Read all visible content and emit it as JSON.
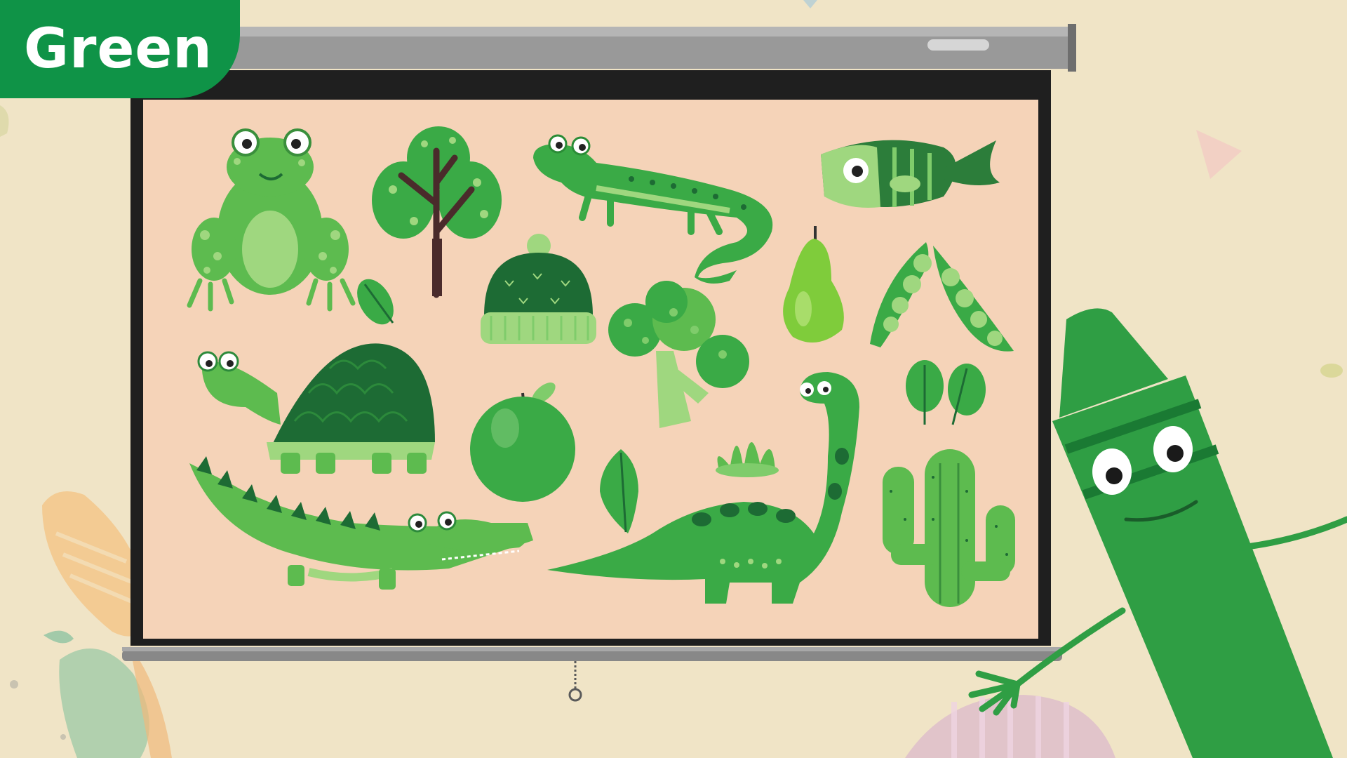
{
  "title": {
    "text": "Green"
  },
  "colors": {
    "background": "#f0e4c6",
    "title_tag": "#0f9347",
    "screen": "#f5d3b8",
    "screen_frame": "#1f1f1f",
    "roller": "#9a9a9a",
    "green_dark": "#1d6b34",
    "green_mid": "#3aaa46",
    "green_light": "#7fcc6b"
  },
  "icons": {
    "projector_screen": "projection-screen-icon",
    "pull_cord": "pull-cord-icon",
    "crayon_character": "green-crayon-character-icon"
  },
  "illustrations": [
    "frog",
    "tree",
    "lizard",
    "fish",
    "leaf",
    "knit-hat",
    "pear",
    "peas",
    "turtle",
    "broccoli",
    "apple",
    "spinach",
    "crocodile",
    "leaf",
    "grass",
    "dinosaur",
    "cactus"
  ]
}
